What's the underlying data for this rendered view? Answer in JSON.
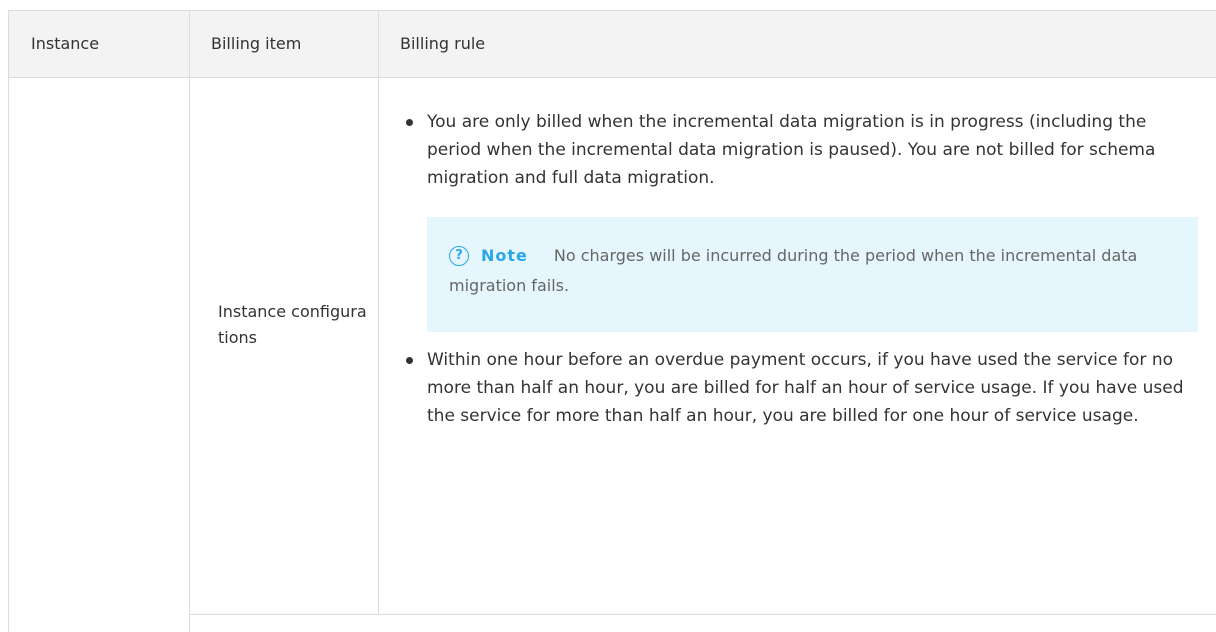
{
  "table": {
    "headers": {
      "instance": "Instance",
      "billing_item": "Billing item",
      "billing_rule": "Billing rule"
    },
    "row1": {
      "billing_item": "Instance configurations",
      "rules": [
        "You are only billed when the incremental data migration is in progress (including the period when the incremental data migration is paused). You are not billed for schema migration and full data migration.",
        "Within one hour before an overdue payment occurs, if you have used the service for no more than half an hour, you are billed for half an hour of service usage. If you have used the service for more than half an hour, you are billed for one hour of service usage."
      ],
      "note": {
        "icon": "question-circle-icon",
        "title": "Note",
        "text": "No charges will be incurred during the period when the incremental data migration fails."
      }
    }
  },
  "colors": {
    "header_bg": "#f3f3f3",
    "border": "#dcdcdc",
    "note_bg": "#e6f6fd",
    "note_accent": "#2aa7e8"
  }
}
